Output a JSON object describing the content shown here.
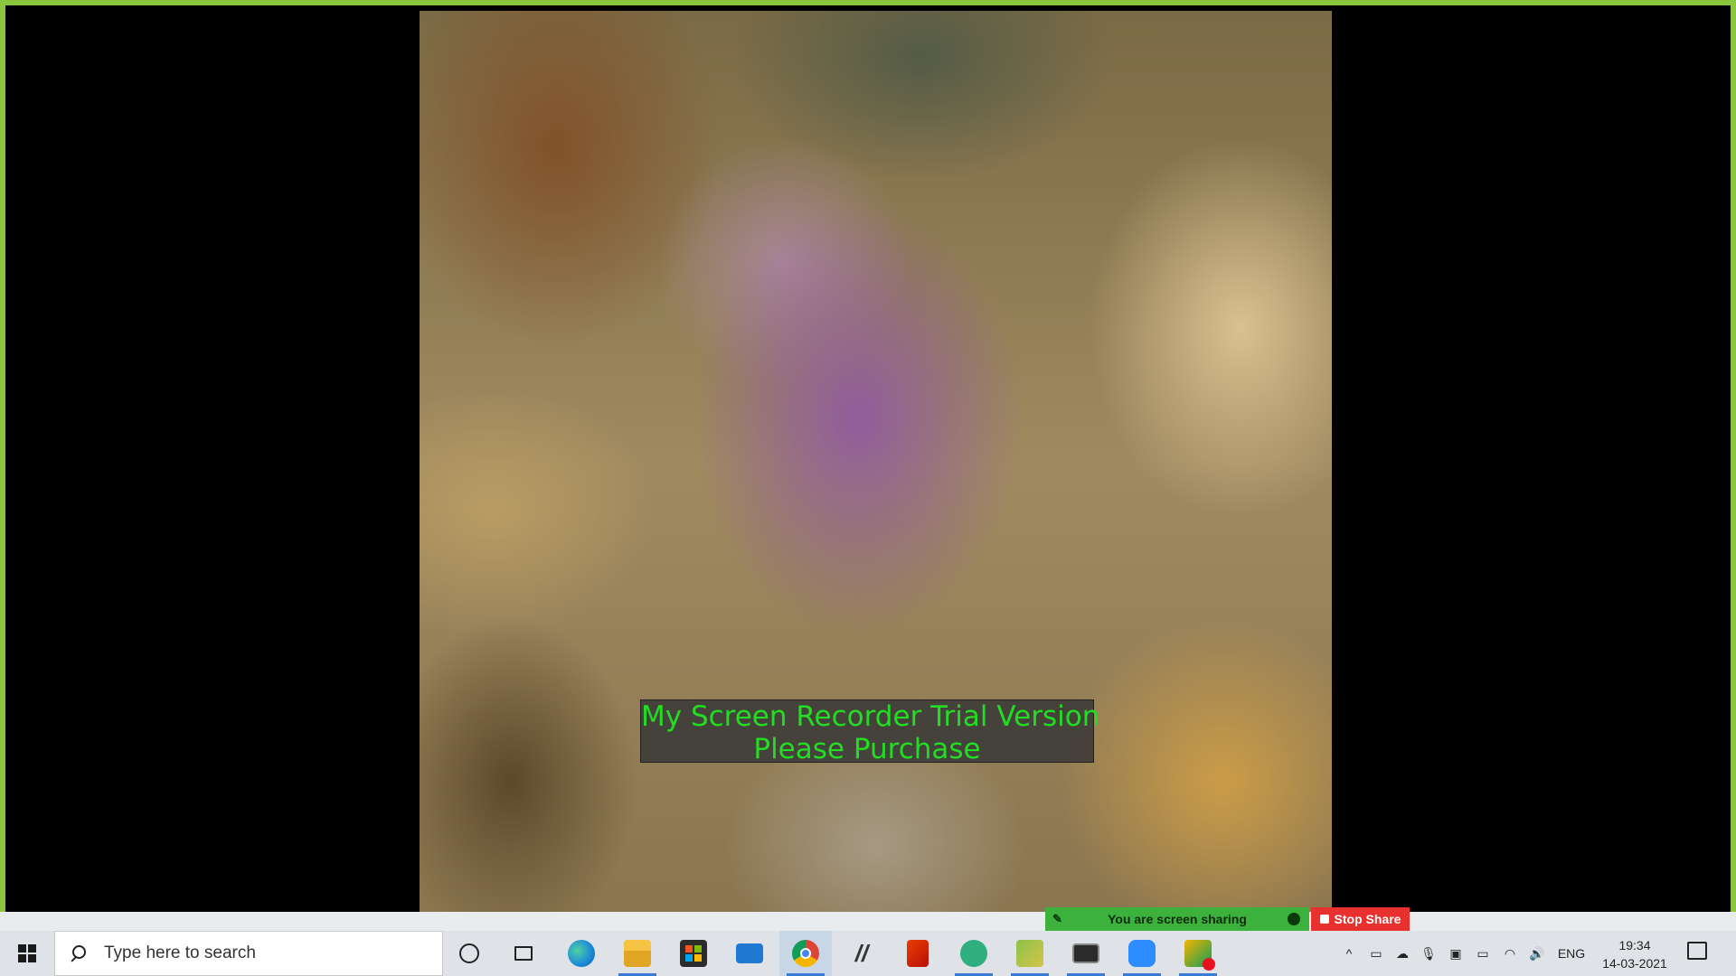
{
  "watermark": {
    "line1": "My Screen Recorder Trial Version",
    "line2": "Please Purchase"
  },
  "share_bar": {
    "label": "You are screen sharing",
    "stop_label": "Stop Share",
    "bar_color": "#3cb23c",
    "stop_color": "#e8302e"
  },
  "taskbar": {
    "search_placeholder": "Type here to search",
    "apps": [
      {
        "name": "cortana-icon"
      },
      {
        "name": "task-view-icon"
      },
      {
        "name": "edge-icon"
      },
      {
        "name": "file-explorer-icon"
      },
      {
        "name": "store-icon"
      },
      {
        "name": "mail-icon"
      },
      {
        "name": "chrome-icon"
      },
      {
        "name": "app-icon"
      },
      {
        "name": "office-icon"
      },
      {
        "name": "app-icon"
      },
      {
        "name": "app-icon"
      },
      {
        "name": "app-icon"
      },
      {
        "name": "zoom-icon"
      },
      {
        "name": "screen-recorder-icon"
      }
    ],
    "tray": {
      "language": "ENG",
      "time": "19:34",
      "date": "14-03-2021"
    }
  }
}
